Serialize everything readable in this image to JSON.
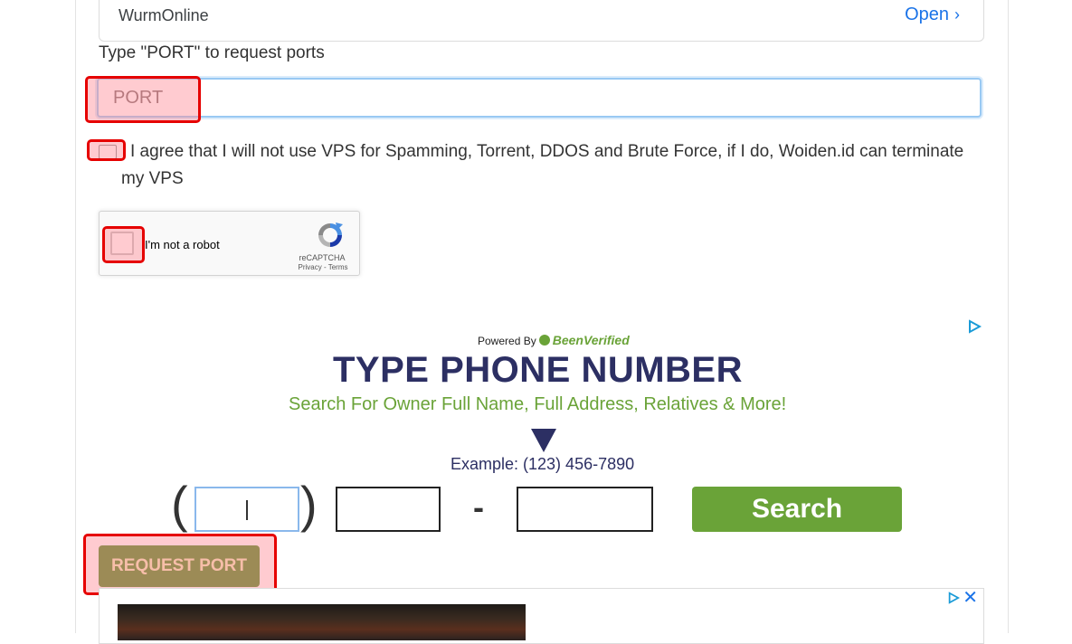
{
  "top_ad": {
    "name": "WurmOnline",
    "open_label": "Open",
    "open_chevron": "›"
  },
  "port_form": {
    "label": "Type \"PORT\" to request ports",
    "input_placeholder": "PORT",
    "input_value": ""
  },
  "agreement": {
    "text": "I agree that I will not use VPS for Spamming, Torrent, DDOS and Brute Force, if I do, Woiden.id can terminate my VPS",
    "checked": false
  },
  "recaptcha": {
    "label": "I'm not a robot",
    "brand": "reCAPTCHA",
    "terms": "Privacy - Terms"
  },
  "phone_ad": {
    "powered_by": "Powered By",
    "brand": "BeenVerified",
    "headline": "TYPE PHONE NUMBER",
    "subheadline": "Search For Owner Full Name, Full Address, Relatives & More!",
    "example": "Example: (123) 456-7890",
    "paren_open": "(",
    "paren_close": ")",
    "dash": "-",
    "search_label": "Search",
    "adchoices_icon": "play-triangle-icon"
  },
  "actions": {
    "request_port_label": "REQUEST PORT"
  },
  "bottom_ad": {
    "close_label": "✕",
    "adchoices_icon": "play-triangle-icon"
  },
  "colors": {
    "accent_blue": "#1a73e8",
    "green": "#6aa338",
    "button_green": "#4c8b22",
    "navy": "#2c2f63",
    "highlight_red": "#e60000"
  }
}
